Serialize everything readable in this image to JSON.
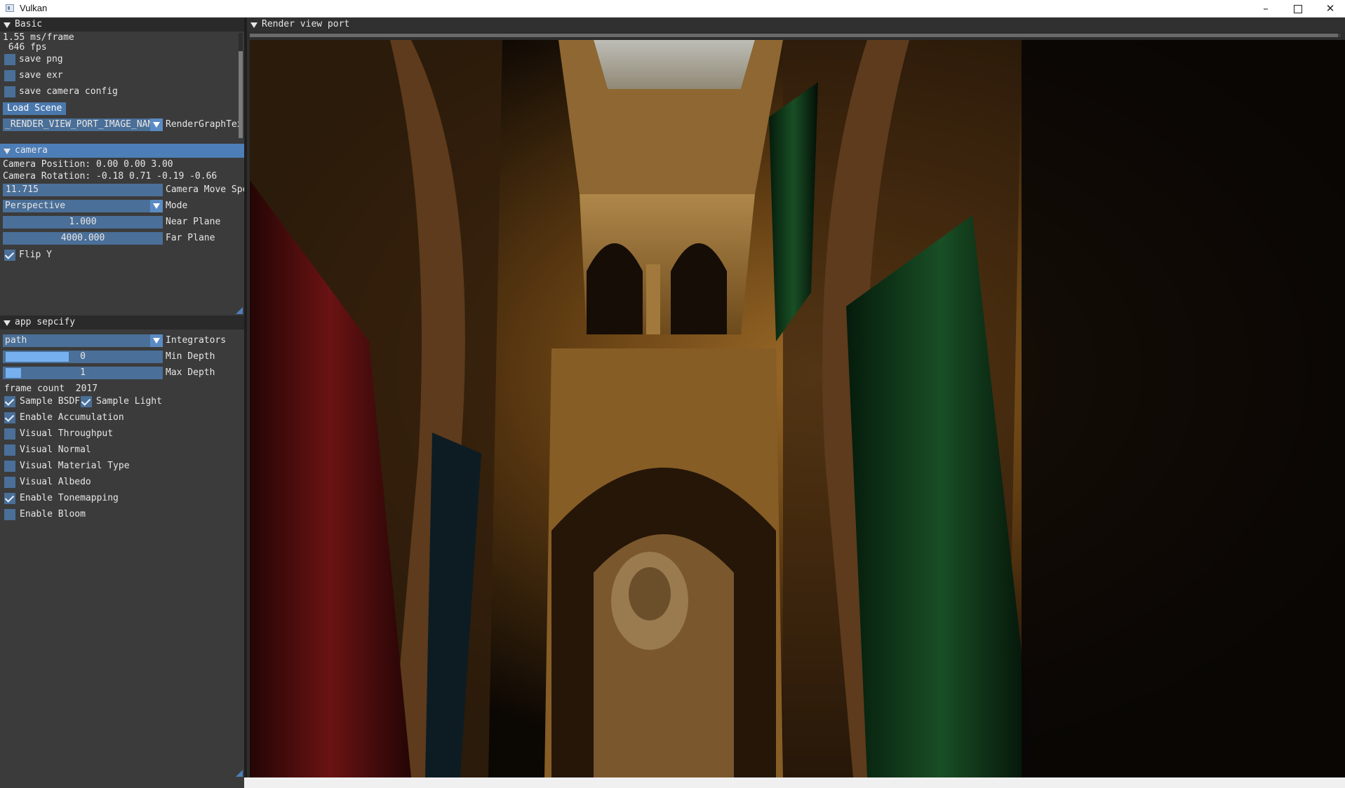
{
  "window": {
    "title": "Vulkan",
    "minimize_glyph": "–",
    "close_glyph": "✕"
  },
  "basic_panel": {
    "header": "Basic",
    "ms_per_frame": "1.55 ms/frame",
    "fps": " 646 fps",
    "save_png": {
      "label": "save png",
      "checked": false
    },
    "save_exr": {
      "label": "save exr",
      "checked": false
    },
    "save_camera_config": {
      "label": "save camera config",
      "checked": false
    },
    "load_scene_button": "Load Scene",
    "image_combo": {
      "value": "_RENDER_VIEW_PORT_IMAGE_NAME_",
      "label": "RenderGraphTex"
    }
  },
  "camera_panel": {
    "header": "camera",
    "position": "Camera Position: 0.00 0.00 3.00",
    "rotation": "Camera Rotation: -0.18 0.71 -0.19 -0.66",
    "move_speed": {
      "value": "11.715",
      "label": "Camera Move Spee"
    },
    "mode": {
      "value": "Perspective",
      "label": "Mode"
    },
    "near_plane": {
      "value": "1.000",
      "label": "Near Plane"
    },
    "far_plane": {
      "value": "4000.000",
      "label": "Far Plane"
    },
    "flip_y": {
      "label": "Flip Y",
      "checked": true
    }
  },
  "app_panel": {
    "header": "app sepcify",
    "integrator": {
      "value": "path",
      "label": "Integrators"
    },
    "min_depth": {
      "value": "0",
      "label": "Min Depth",
      "fraction": 0.41
    },
    "max_depth": {
      "value": "1",
      "label": "Max Depth",
      "fraction": 0.1
    },
    "frame_count": "frame count  2017",
    "sample_bsdf": {
      "label": "Sample BSDF",
      "checked": true
    },
    "sample_light": {
      "label": "Sample Light",
      "checked": true
    },
    "checkboxes": [
      {
        "label": "Enable Accumulation",
        "checked": true
      },
      {
        "label": "Visual Throughput",
        "checked": false
      },
      {
        "label": "Visual Normal",
        "checked": false
      },
      {
        "label": "Visual Material Type",
        "checked": false
      },
      {
        "label": "Visual Albedo",
        "checked": false
      },
      {
        "label": "Enable Tonemapping",
        "checked": true
      },
      {
        "label": "Enable Bloom",
        "checked": false
      }
    ]
  },
  "viewport": {
    "header": "Render view port"
  },
  "colors": {
    "header_active": "#4d7eb8",
    "widget_bg": "#4a6f98",
    "panel_bg": "#3b3b3b"
  }
}
